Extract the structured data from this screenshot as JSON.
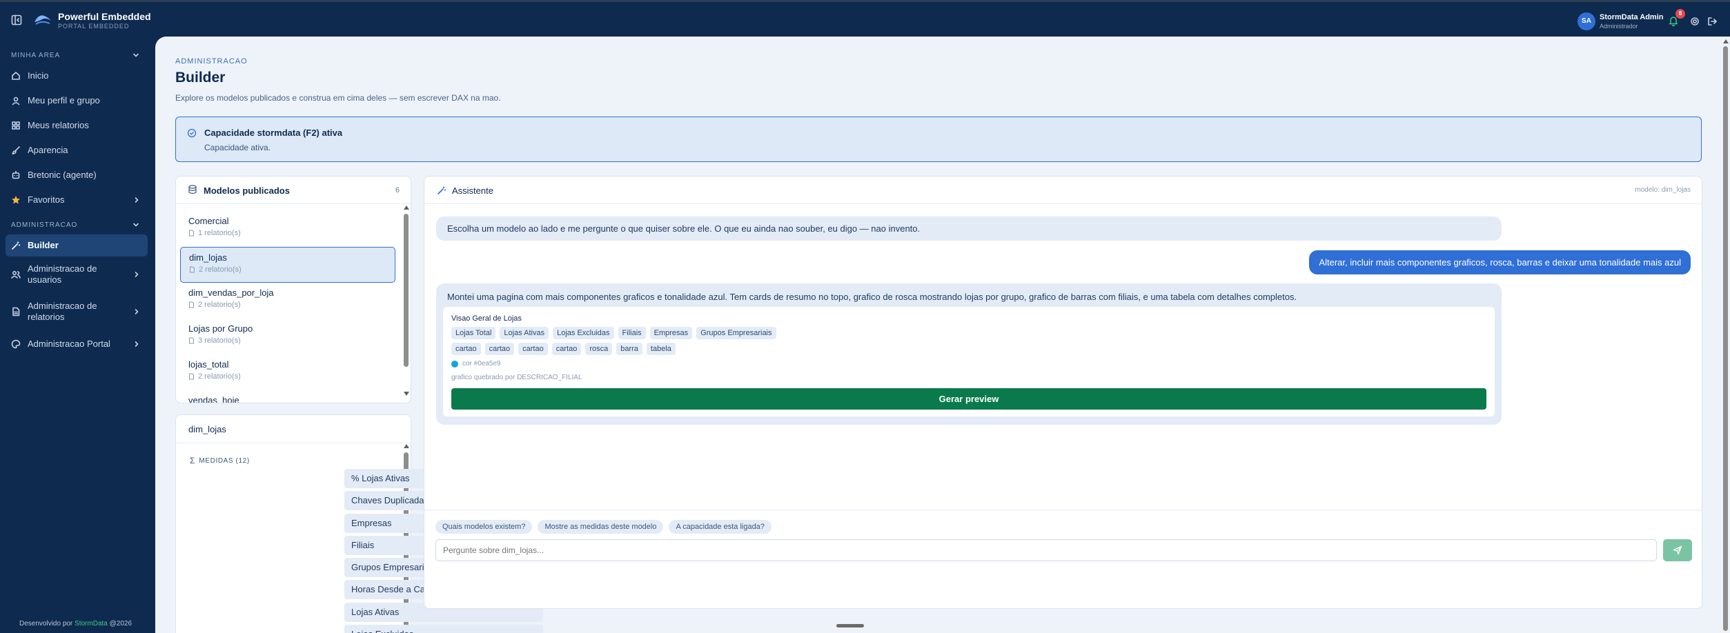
{
  "app": {
    "title": "Powerful Embedded",
    "subtitle": "PORTAL EMBEDDED",
    "footer_prefix": "Desenvolvido por",
    "footer_brand": "StormData",
    "footer_year": "@2026"
  },
  "user": {
    "initials": "SA",
    "name": "StormData Admin",
    "role": "Administrador",
    "notifications": "8"
  },
  "sidebar": {
    "section1": "MINHA AREA",
    "items1": [
      {
        "label": "Inicio"
      },
      {
        "label": "Meu perfil e grupo"
      },
      {
        "label": "Meus relatorios"
      },
      {
        "label": "Aparencia"
      },
      {
        "label": "Bretonic (agente)"
      },
      {
        "label": "Favoritos"
      }
    ],
    "section2": "ADMINISTRACAO",
    "items2": [
      {
        "label": "Builder"
      },
      {
        "label": "Administracao de usuarios"
      },
      {
        "label": "Administracao de relatorios"
      },
      {
        "label": "Administracao Portal"
      }
    ]
  },
  "page": {
    "breadcrumb": "ADMINISTRACAO",
    "title": "Builder",
    "description": "Explore os modelos publicados e construa em cima deles — sem escrever DAX na mao."
  },
  "capacity": {
    "title": "Capacidade stormdata (F2) ativa",
    "status": "Capacidade ativa."
  },
  "models": {
    "title": "Modelos publicados",
    "count": "6",
    "items": [
      {
        "name": "Comercial",
        "reports": "1 relatorio(s)"
      },
      {
        "name": "dim_lojas",
        "reports": "2 relatorio(s)"
      },
      {
        "name": "dim_vendas_por_loja",
        "reports": "2 relatorio(s)"
      },
      {
        "name": "Lojas por Grupo",
        "reports": "3 relatorio(s)"
      },
      {
        "name": "lojas_total",
        "reports": "2 relatorio(s)"
      },
      {
        "name": "vendas_hoje",
        "reports": ""
      }
    ]
  },
  "detail": {
    "title": "dim_lojas",
    "measures_label": "MEDIDAS (12)",
    "measures": [
      "% Lojas Ativas",
      "Chaves Duplicadas",
      "Empresas",
      "Filiais",
      "Grupos Empresariais",
      "Horas Desde a Carga",
      "Lojas Ativas",
      "Lojas Excluidas"
    ]
  },
  "assistant": {
    "title": "Assistente",
    "model_tag": "modelo: dim_lojas",
    "msg1": "Escolha um modelo ao lado e me pergunte o que quiser sobre ele. O que eu ainda nao souber, eu digo — nao invento.",
    "msg2": "Alterar, incluir mais componentes graficos, rosca, barras e deixar uma tonalidade mais azul",
    "msg3": "Montei uma pagina com mais componentes graficos e tonalidade azul. Tem cards de resumo no topo, grafico de rosca mostrando lojas por grupo, grafico de barras com filiais, e uma tabela com detalhes completos.",
    "plan": {
      "title": "Visao Geral de Lojas",
      "measures": [
        "Lojas Total",
        "Lojas Ativas",
        "Lojas Excluidas",
        "Filiais",
        "Empresas",
        "Grupos Empresariais"
      ],
      "visuals": [
        "cartao",
        "cartao",
        "cartao",
        "cartao",
        "rosca",
        "barra",
        "tabela"
      ],
      "color_label": "cor #0ea5e9",
      "color": "#0ea5e9",
      "breakdown": "grafico quebrado por DESCRICAO_FILIAL",
      "button": "Gerar preview"
    },
    "suggestions": [
      "Quais modelos existem?",
      "Mostre as medidas deste modelo",
      "A capacidade esta ligada?"
    ],
    "input_placeholder": "Pergunte sobre dim_lojas..."
  }
}
